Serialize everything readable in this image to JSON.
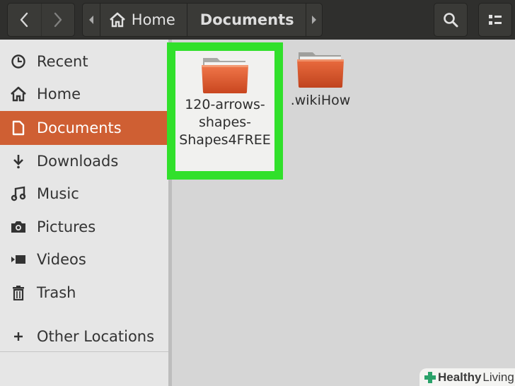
{
  "header": {
    "nav": {
      "back_icon": "chevron-left-icon",
      "forward_icon": "chevron-right-icon"
    },
    "path": {
      "crumbs": [
        {
          "label": "Home",
          "icon": "home-icon"
        },
        {
          "label": "Documents"
        }
      ]
    },
    "actions": {
      "search_icon": "search-icon",
      "view_icon": "view-options-icon"
    }
  },
  "sidebar": {
    "items": [
      {
        "label": "Recent",
        "icon": "clock-icon"
      },
      {
        "label": "Home",
        "icon": "home-icon"
      },
      {
        "label": "Documents",
        "icon": "document-icon",
        "active": true
      },
      {
        "label": "Downloads",
        "icon": "download-icon"
      },
      {
        "label": "Music",
        "icon": "music-icon"
      },
      {
        "label": "Pictures",
        "icon": "camera-icon"
      },
      {
        "label": "Videos",
        "icon": "video-icon"
      },
      {
        "label": "Trash",
        "icon": "trash-icon"
      }
    ],
    "other_locations": {
      "label": "Other Locations",
      "icon": "plus-icon"
    }
  },
  "files": [
    {
      "name": "120-arrows-shapes-Shapes4FREE",
      "type": "folder",
      "selected": true
    },
    {
      "name": ".wikiHow",
      "type": "folder",
      "selected": false
    }
  ],
  "watermark": {
    "brand_part1": "Healthy",
    "brand_part2": "Living"
  },
  "colors": {
    "header_bg": "#2f2f2d",
    "sidebar_bg": "#e6e6e6",
    "active_item": "#cf5f33",
    "selection_highlight": "#31e02b",
    "folder": "#d9582b"
  }
}
